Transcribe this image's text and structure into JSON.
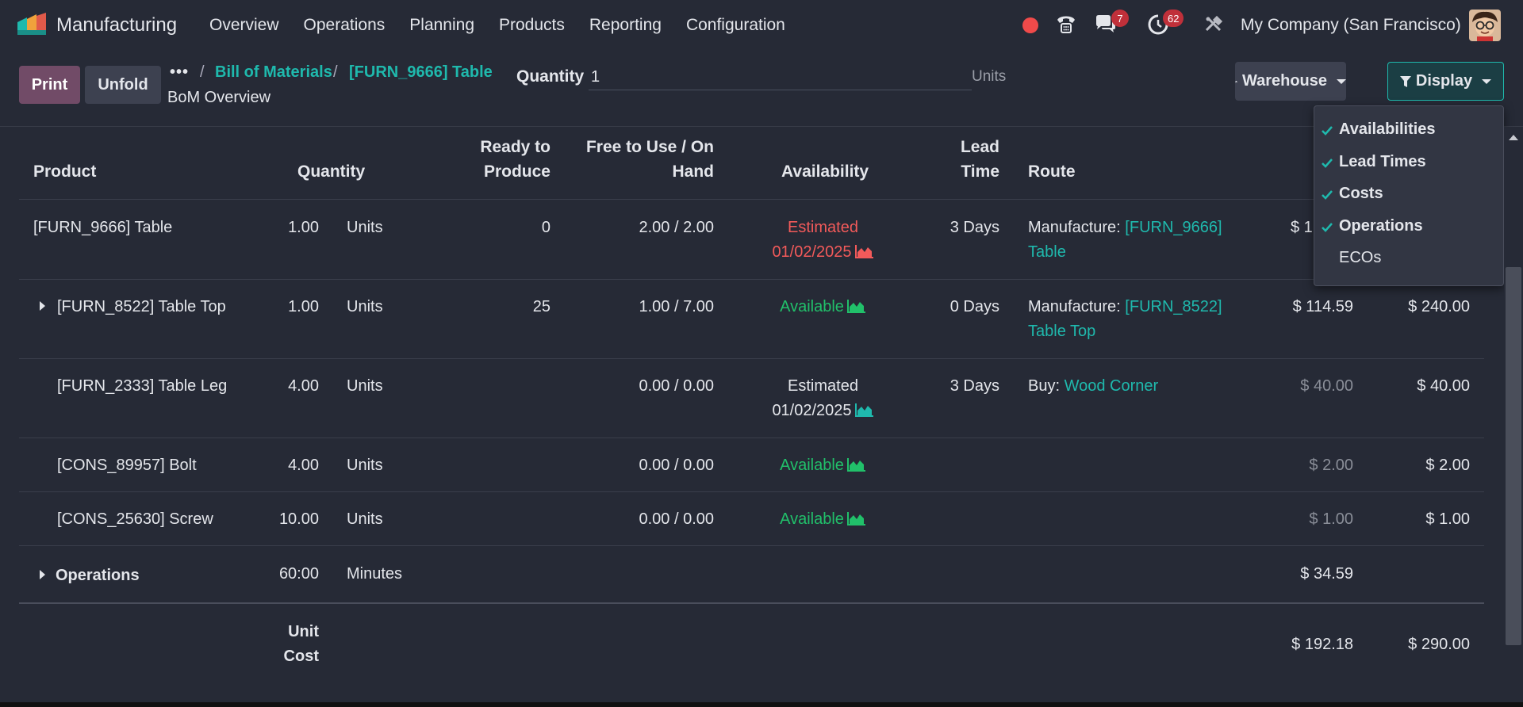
{
  "navbar": {
    "app_name": "Manufacturing",
    "menu": [
      "Overview",
      "Operations",
      "Planning",
      "Products",
      "Reporting",
      "Configuration"
    ],
    "chat_badge": "7",
    "activity_badge": "62",
    "company": "My Company (San Francisco)"
  },
  "control": {
    "print_label": "Print",
    "unfold_label": "Unfold",
    "breadcrumb_dots": "•••",
    "breadcrumb_sep": "/",
    "breadcrumb_bom": "Bill of Materials",
    "breadcrumb_table": "[FURN_9666] Table",
    "subtitle": "BoM Overview",
    "quantity_label": "Quantity",
    "quantity_value": "1",
    "quantity_unit": "Units",
    "warehouse_label": "Warehouse",
    "display_label": "Display"
  },
  "display_menu": [
    {
      "label": "Availabilities",
      "checked": true
    },
    {
      "label": "Lead Times",
      "checked": true
    },
    {
      "label": "Costs",
      "checked": true
    },
    {
      "label": "Operations",
      "checked": true
    },
    {
      "label": "ECOs",
      "checked": false
    }
  ],
  "table": {
    "headers": {
      "product": "Product",
      "quantity": "Quantity",
      "ready_1": "Ready to",
      "ready_2": "Produce",
      "free_1": "Free to Use / On",
      "free_2": "Hand",
      "availability": "Availability",
      "lead_1": "Lead",
      "lead_2": "Time",
      "route": "Route"
    },
    "rows": [
      {
        "product": "[FURN_9666] Table",
        "qty": "1.00",
        "uom": "Units",
        "ready": "0",
        "free": "2.00 / 2.00",
        "avail_1": "Estimated",
        "avail_2": "01/02/2025",
        "lead": "3 Days",
        "route_prefix": "Manufacture:",
        "route_link_1": "[FURN_9666]",
        "route_link_2": "Table",
        "cost": "$ 1"
      },
      {
        "product": "[FURN_8522] Table Top",
        "qty": "1.00",
        "uom": "Units",
        "ready": "25",
        "free": "1.00 / 7.00",
        "avail_1": "Available",
        "lead": "0 Days",
        "route_prefix": "Manufacture:",
        "route_link_1": "[FURN_8522]",
        "route_link_2": "Table Top",
        "cost": "$ 114.59",
        "bom_cost": "$ 240.00"
      },
      {
        "product": "[FURN_2333] Table Leg",
        "qty": "4.00",
        "uom": "Units",
        "free": "0.00 / 0.00",
        "avail_1": "Estimated",
        "avail_2": "01/02/2025",
        "lead": "3 Days",
        "route_prefix": "Buy:",
        "route_link_1": "Wood Corner",
        "cost": "$ 40.00",
        "bom_cost": "$ 40.00"
      },
      {
        "product": "[CONS_89957] Bolt",
        "qty": "4.00",
        "uom": "Units",
        "free": "0.00 / 0.00",
        "avail_1": "Available",
        "cost": "$ 2.00",
        "bom_cost": "$ 2.00"
      },
      {
        "product": "[CONS_25630] Screw",
        "qty": "10.00",
        "uom": "Units",
        "free": "0.00 / 0.00",
        "avail_1": "Available",
        "cost": "$ 1.00",
        "bom_cost": "$ 1.00"
      }
    ],
    "operations": {
      "label": "Operations",
      "qty": "60:00",
      "uom": "Minutes",
      "cost": "$ 34.59"
    },
    "unit_cost": {
      "label_1": "Unit",
      "label_2": "Cost",
      "cost": "$ 192.18",
      "bom_cost": "$ 290.00"
    }
  },
  "colors": {
    "accent": "#1fb9ad",
    "print": "#714b67",
    "late": "#f35a5a",
    "available": "#21c06a"
  }
}
